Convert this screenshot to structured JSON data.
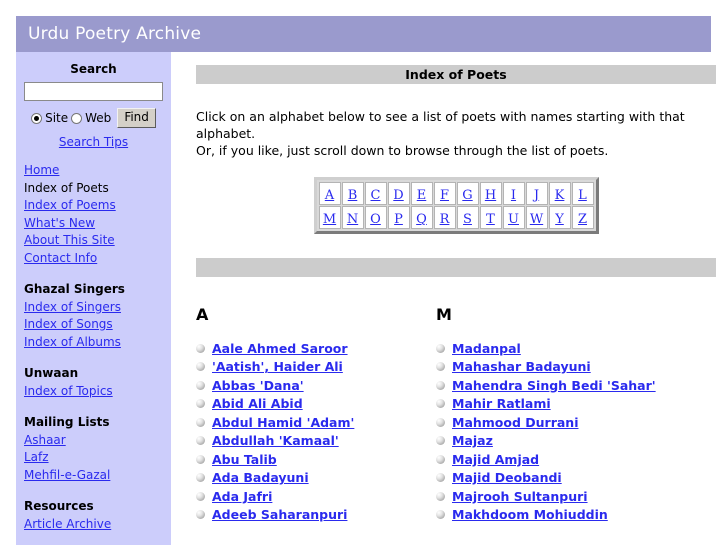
{
  "site": {
    "title": "Urdu Poetry Archive",
    "header_bg": "#9a9acd",
    "sidebar_bg": "#cccdfb",
    "bar_bg": "#cccccc",
    "link_color": "#2a2aee"
  },
  "sidebar": {
    "search": {
      "heading": "Search",
      "input_value": "",
      "input_placeholder": "",
      "scope_site_label": "Site",
      "scope_web_label": "Web",
      "scope_selected": "Site",
      "find_label": "Find",
      "tips_label": "Search Tips"
    },
    "nav_main": [
      {
        "label": "Home",
        "current": false
      },
      {
        "label": "Index of Poets",
        "current": true
      },
      {
        "label": "Index of Poems",
        "current": false
      },
      {
        "label": "What's New",
        "current": false
      },
      {
        "label": "About This Site",
        "current": false
      },
      {
        "label": "Contact Info",
        "current": false
      }
    ],
    "groups": [
      {
        "title": "Ghazal Singers",
        "items": [
          "Index of Singers",
          "Index of Songs",
          "Index of Albums"
        ]
      },
      {
        "title": "Unwaan",
        "items": [
          "Index of Topics"
        ]
      },
      {
        "title": "Mailing Lists",
        "items": [
          "Ashaar",
          "Lafz",
          "Mehfil-e-Gazal"
        ]
      },
      {
        "title": "Resources",
        "items": [
          "Article Archive"
        ]
      }
    ]
  },
  "main": {
    "page_title": "Index of Poets",
    "intro_line1": "Click on an alphabet below to see a list of poets with names starting with that alphabet.",
    "intro_line2": "Or, if you like, just scroll down to browse through the list of poets.",
    "alphabet_row1": [
      "A",
      "B",
      "C",
      "D",
      "E",
      "F",
      "G",
      "H",
      "I",
      "J",
      "K",
      "L"
    ],
    "alphabet_row2": [
      "M",
      "N",
      "O",
      "P",
      "Q",
      "R",
      "S",
      "T",
      "U",
      "W",
      "Y",
      "Z"
    ],
    "columns": [
      {
        "letter": "A",
        "poets": [
          "Aale Ahmed Saroor",
          "'Aatish', Haider Ali",
          "Abbas 'Dana'",
          "Abid Ali Abid",
          "Abdul Hamid 'Adam'",
          "Abdullah 'Kamaal'",
          "Abu Talib",
          "Ada Badayuni",
          "Ada Jafri",
          "Adeeb Saharanpuri"
        ]
      },
      {
        "letter": "M",
        "poets": [
          "Madanpal",
          "Mahashar Badayuni",
          "Mahendra Singh Bedi 'Sahar'",
          "Mahir Ratlami",
          "Mahmood Durrani",
          "Majaz",
          "Majid Amjad",
          "Majid Deobandi",
          "Majrooh Sultanpuri",
          "Makhdoom Mohiuddin"
        ]
      }
    ]
  }
}
